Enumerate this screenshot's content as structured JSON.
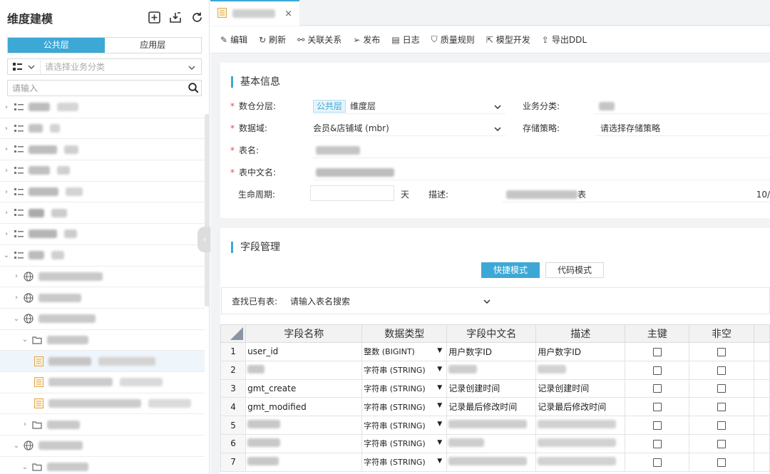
{
  "sidebar": {
    "title": "维度建模",
    "tabs": [
      "公共层",
      "应用层"
    ],
    "category_placeholder": "请选择业务分类",
    "search_placeholder": "请输入"
  },
  "tab": {
    "close_glyph": "×"
  },
  "toolbar": {
    "items": [
      {
        "label": "编辑",
        "icon": "edit-icon"
      },
      {
        "label": "刷新",
        "icon": "refresh-icon"
      },
      {
        "label": "关联关系",
        "icon": "link-icon"
      },
      {
        "label": "发布",
        "icon": "send-icon"
      },
      {
        "label": "日志",
        "icon": "log-icon"
      },
      {
        "label": "质量规则",
        "icon": "shield-icon"
      },
      {
        "label": "模型开发",
        "icon": "external-link-icon"
      },
      {
        "label": "导出DDL",
        "icon": "export-icon"
      }
    ]
  },
  "basic": {
    "title": "基本信息",
    "layer_label": "数仓分层:",
    "layer_tag": "公共层",
    "layer_value": "维度层",
    "biz_label": "业务分类:",
    "domain_label": "数据域:",
    "domain_value": "会员&店铺域 (mbr)",
    "storage_label": "存储策略:",
    "storage_value": "请选择存储策略",
    "table_name_label": "表名:",
    "table_cn_label": "表中文名:",
    "lifecycle_label": "生命周期:",
    "lifecycle_unit": "天",
    "desc_label": "描述:",
    "desc_tail": "表",
    "counter": "10/"
  },
  "fields": {
    "title": "字段管理",
    "quick_mode": "快捷模式",
    "code_mode": "代码模式",
    "find_label": "查找已有表:",
    "find_placeholder": "请输入表名搜索",
    "columns": [
      "字段名称",
      "数据类型",
      "字段中文名",
      "描述",
      "主键",
      "非空"
    ],
    "rows": [
      {
        "num": "1",
        "name": "user_id",
        "type": "整数 (BIGINT)",
        "cn": "用户数字ID",
        "desc": "用户数字ID"
      },
      {
        "num": "2",
        "name": "",
        "type": "字符串 (STRING)",
        "cn": "",
        "desc": ""
      },
      {
        "num": "3",
        "name": "gmt_create",
        "type": "字符串 (STRING)",
        "cn": "记录创建时间",
        "desc": "记录创建时间"
      },
      {
        "num": "4",
        "name": "gmt_modified",
        "type": "字符串 (STRING)",
        "cn": "记录最后修改时间",
        "desc": "记录最后修改时间"
      },
      {
        "num": "5",
        "name": "",
        "type": "字符串 (STRING)",
        "cn": "",
        "desc": ""
      },
      {
        "num": "6",
        "name": "",
        "type": "字符串 (STRING)",
        "cn": "",
        "desc": ""
      },
      {
        "num": "7",
        "name": "",
        "type": "字符串 (STRING)",
        "cn": "",
        "desc": ""
      }
    ]
  },
  "colors": {
    "accent": "#3da8d5",
    "required": "#e5484d"
  }
}
